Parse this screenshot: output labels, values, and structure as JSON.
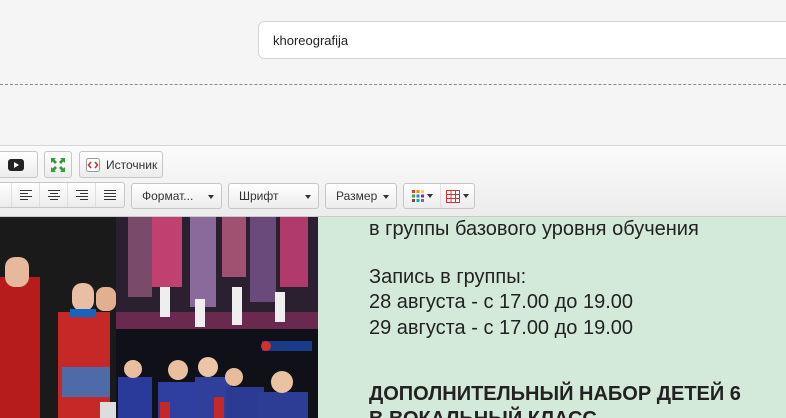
{
  "slug_field": {
    "value": "khoreografija"
  },
  "toolbar": {
    "row1": {
      "source_label": "Источник"
    },
    "row2": {
      "format_label": "Формат...",
      "font_label": "Шрифт",
      "size_label": "Размер"
    }
  },
  "content": {
    "lines": [
      "в группы базового уровня обучения",
      "Запись в группы:",
      "28 августа - с 17.00 до 19.00",
      "29 августа - с 17.00 до 19.00",
      "ДОПОЛНИТЕЛЬНЫЙ НАБОР ДЕТЕЙ 6",
      "В ВОКАЛЬНЫЙ КЛАСС"
    ]
  },
  "colors": {
    "content_bg": "#d3e9da",
    "toolbar_bg": "#f0f0f0"
  }
}
